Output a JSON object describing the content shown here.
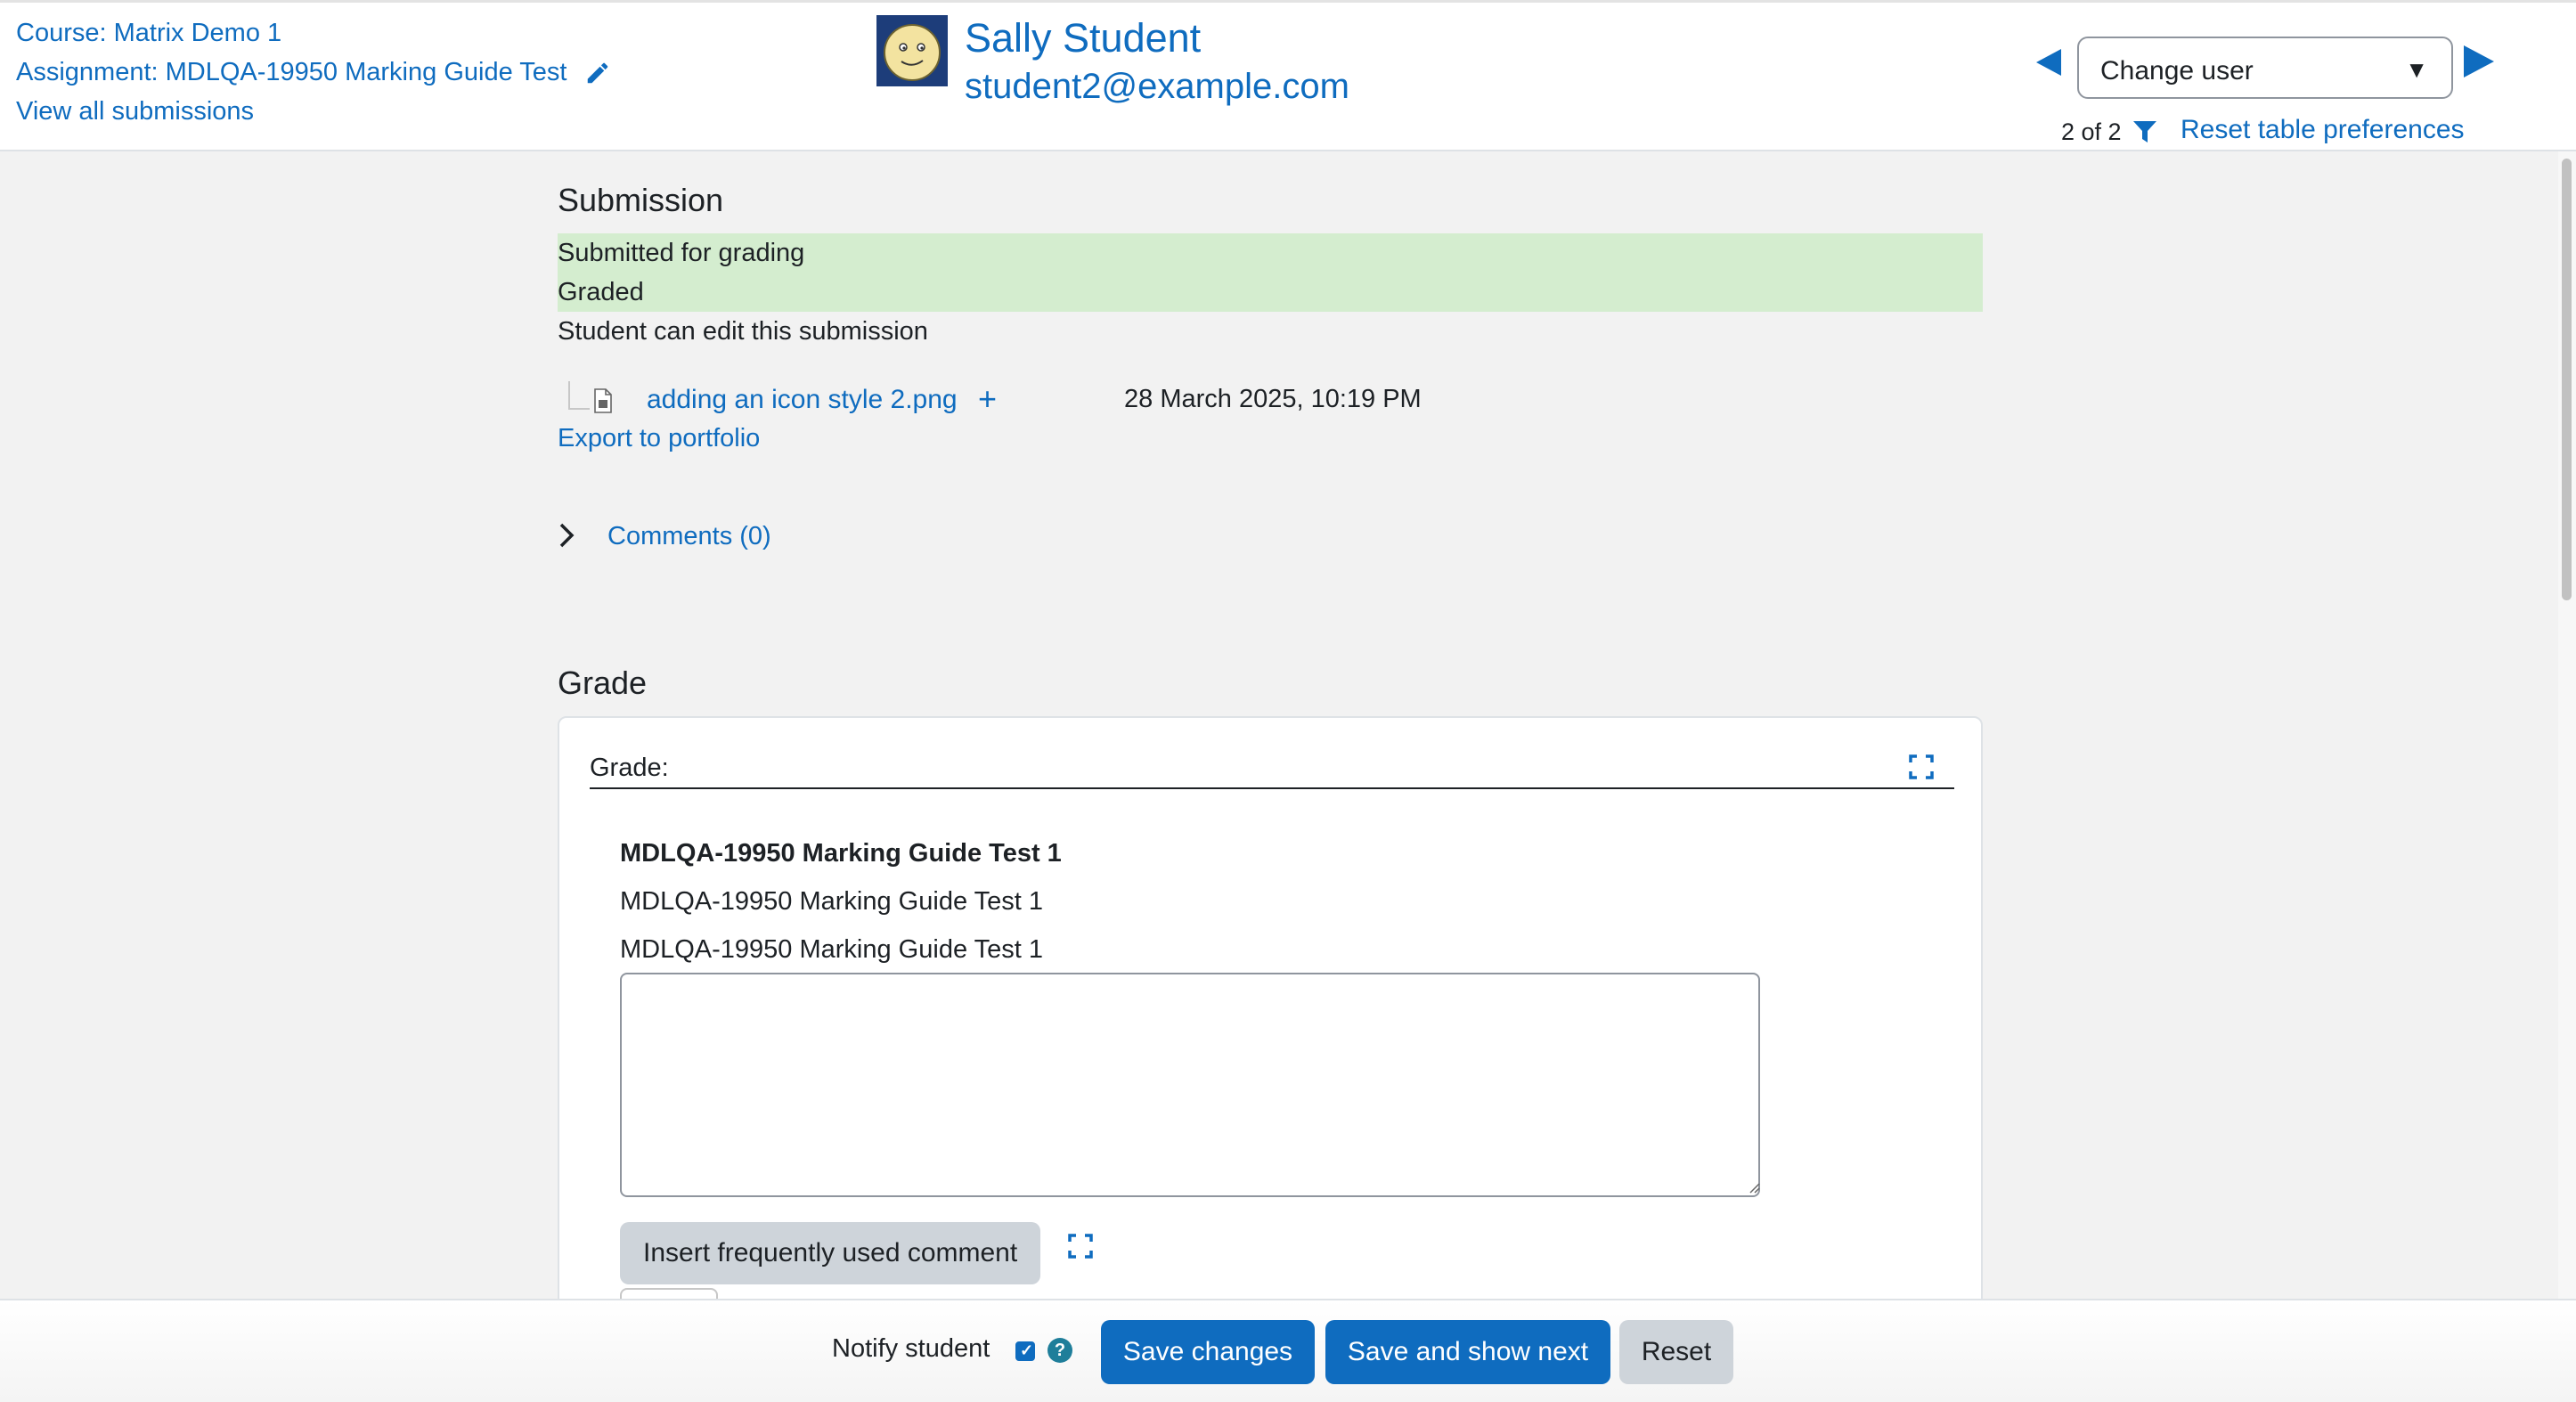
{
  "header": {
    "course_link": "Course: Matrix Demo 1",
    "assignment_link": "Assignment: MDLQA-19950 Marking Guide Test",
    "view_all_link": "View all submissions",
    "user": {
      "name": "Sally Student",
      "email": "student2@example.com"
    },
    "change_user": {
      "selected": "Change user"
    },
    "counter": "2 of 2",
    "reset_preferences": "Reset table preferences"
  },
  "submission": {
    "title": "Submission",
    "status_submitted": "Submitted for grading",
    "status_graded": "Graded",
    "edit_note": "Student can edit this submission",
    "file": {
      "name": "adding an icon style 2.png",
      "date": "28 March 2025, 10:19 PM"
    },
    "export_link": "Export to portfolio",
    "comments_link": "Comments (0)"
  },
  "grade": {
    "title": "Grade",
    "label": "Grade:",
    "criterion_name": "MDLQA-19950 Marking Guide Test 1",
    "criterion_description": "MDLQA-19950 Marking Guide Test 1",
    "criterion_description_2": "MDLQA-19950 Marking Guide Test 1",
    "remark_value": "",
    "frequent_comment_button": "Insert frequently used comment"
  },
  "footer": {
    "notify_label": "Notify student",
    "notify_checked": true,
    "help_glyph": "?",
    "save_changes": "Save changes",
    "save_and_next": "Save and show next",
    "reset": "Reset"
  },
  "colors": {
    "link": "#0f6cbf",
    "primary_button": "#0f6cbf",
    "secondary_button": "#ced4da",
    "status_success_bg": "#d4edcf"
  },
  "icons": [
    "pencil-icon",
    "avatar",
    "prev-arrow-icon",
    "next-arrow-icon",
    "filter-icon",
    "file-icon",
    "plus-icon",
    "chevron-right-icon",
    "expand-icon",
    "help-icon"
  ]
}
